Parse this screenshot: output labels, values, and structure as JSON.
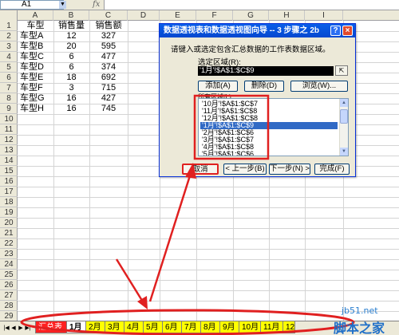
{
  "formula_bar": {
    "name_box": "A1",
    "fx": "fx"
  },
  "columns": [
    "A",
    "B",
    "C",
    "D",
    "E",
    "F",
    "G",
    "H",
    "I"
  ],
  "rows": [
    "1",
    "2",
    "3",
    "4",
    "5",
    "6",
    "7",
    "8",
    "9",
    "10",
    "11",
    "12",
    "13",
    "14",
    "15",
    "16",
    "17",
    "18",
    "19",
    "20",
    "21",
    "22",
    "23",
    "24",
    "25",
    "26",
    "27",
    "28",
    "29"
  ],
  "table": {
    "headers": [
      "车型",
      "销售量",
      "销售额"
    ],
    "rows": [
      [
        "车型A",
        "12",
        "327"
      ],
      [
        "车型B",
        "20",
        "595"
      ],
      [
        "车型C",
        "6",
        "477"
      ],
      [
        "车型D",
        "6",
        "374"
      ],
      [
        "车型E",
        "18",
        "692"
      ],
      [
        "车型F",
        "3",
        "715"
      ],
      [
        "车型G",
        "16",
        "427"
      ],
      [
        "车型H",
        "16",
        "745"
      ]
    ]
  },
  "dialog": {
    "title": "数据透视表和数据透视图向导 -- 3 步骤之 2b",
    "help": "?",
    "close": "×",
    "description": "请键入或选定包含汇总数据的工作表数据区域。",
    "range_label": "选定区域(R):",
    "range_value": "'1月'!$A$1:$C$9",
    "add_button": "添加(A)",
    "delete_button": "删除(D)",
    "browse_button": "浏览(W)...",
    "list_label": "所有区域(L):",
    "list_items": [
      "'10月'!$A$1:$C$7",
      "'11月'!$A$1:$C$8",
      "'12月'!$A$1:$C$8",
      "'1月'!$A$1:$C$9",
      "'2月'!$A$1:$C$6",
      "'3月'!$A$1:$C$7",
      "'4月'!$A$1:$C$8",
      "'5月'!$A$1:$C$6"
    ],
    "selected_index": 3,
    "cancel_button": "取消",
    "back_button": "< 上一步(B)",
    "next_button": "下一步(N) >",
    "finish_button": "完成(F)"
  },
  "tabs": {
    "nav": [
      "|◀",
      "◀",
      "▶",
      "▶|"
    ],
    "items": [
      "汇总表",
      "1月",
      "2月",
      "3月",
      "4月",
      "5月",
      "6月",
      "7月",
      "8月",
      "9月",
      "10月",
      "11月",
      "12"
    ],
    "active_index": 1,
    "colors": {
      "summary": "#ff2020",
      "month": "#ffff00",
      "annotation": "#e02020"
    }
  },
  "watermark": {
    "site": "jb51.net",
    "brand": "脚本之家"
  }
}
